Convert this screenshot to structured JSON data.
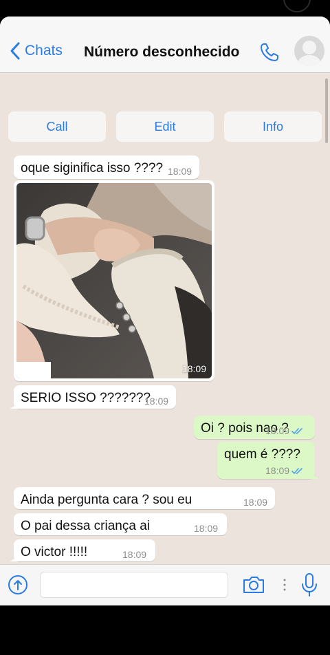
{
  "header": {
    "back_label": "Chats",
    "title": "Número desconhecido"
  },
  "actions": {
    "call": "Call",
    "edit": "Edit",
    "info": "Info"
  },
  "messages": [
    {
      "text": "oque siginifica isso ????",
      "time": "18:09",
      "dir": "in"
    },
    {
      "type": "image",
      "time": "18:09",
      "dir": "in"
    },
    {
      "text": "SERIO ISSO ???????",
      "time": "18:09",
      "dir": "in"
    },
    {
      "text": "Oi ? pois nao ?",
      "time": "18:09",
      "dir": "out"
    },
    {
      "text": "quem é ????",
      "time": "18:09",
      "dir": "out"
    },
    {
      "text": "Ainda pergunta cara ? sou eu",
      "time": "18:09",
      "dir": "in"
    },
    {
      "text": "O pai dessa criança ai",
      "time": "18:09",
      "dir": "in"
    },
    {
      "text": "O victor !!!!!",
      "time": "18:09",
      "dir": "in"
    }
  ],
  "input": {
    "placeholder": ""
  },
  "colors": {
    "accent": "#2a7be4",
    "outgoing": "#dcf8c6",
    "incoming": "#ffffff",
    "background": "#ebe3dc",
    "read_ticks": "#4fa3e8"
  },
  "icons": [
    "chevron-left-icon",
    "phone-icon",
    "avatar-icon",
    "upload-icon",
    "camera-icon",
    "more-icon",
    "microphone-icon"
  ]
}
